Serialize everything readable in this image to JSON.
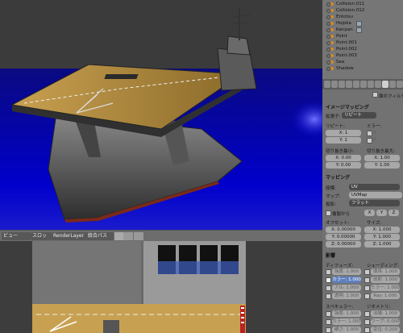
{
  "outliner": {
    "items": [
      {
        "name": "Collision.011"
      },
      {
        "name": "Collision.012"
      },
      {
        "name": "Entotsu"
      },
      {
        "name": "Hojoka"
      },
      {
        "name": "Kanpan"
      },
      {
        "name": "Point"
      },
      {
        "name": "Point.001"
      },
      {
        "name": "Point.002"
      },
      {
        "name": "Point.003"
      },
      {
        "name": "Sea"
      },
      {
        "name": "Shadow"
      }
    ]
  },
  "properties": {
    "filter_label": "面のフィルター",
    "image_mapping": {
      "title": "イメージマッピング",
      "extension_label": "拡張子:",
      "extension_value": "リピート",
      "repeat_label": "リピート:",
      "mirror_label": "ミラー:",
      "repeat_x": "X: 1",
      "repeat_y": "Y: 1",
      "mirror_x": "X",
      "mirror_y": "Y",
      "crop_min_label": "切り抜き最小:",
      "crop_max_label": "切り抜き最大:",
      "crop_min_x": "X: 0.00",
      "crop_min_y": "Y: 0.00",
      "crop_max_x": "X: 1.00",
      "crop_max_y": "Y: 1.00"
    },
    "mapping": {
      "title": "マッピング",
      "coords_label": "座標:",
      "coords_value": "UV",
      "map_label": "マップ:",
      "map_value": "UVMap",
      "projection_label": "投影:",
      "projection_value": "フラット",
      "from_dupli_label": "複製から",
      "axes": [
        "X",
        "Y",
        "Z"
      ],
      "offset_label": "オフセット:",
      "size_label": "サイズ:",
      "offset_x": "X: 0.00000",
      "offset_y": "Y: 0.00000",
      "offset_z": "Z: 0.00000",
      "size_x": "X: 1.000",
      "size_y": "Y: 1.000",
      "size_z": "Z: 1.000"
    },
    "influence": {
      "title": "影響",
      "diffuse_label": "ディフューズ:",
      "shading_label": "シェーディング:",
      "diffuse_items": [
        "強度: 1.000",
        "カラー: 1.000",
        "アル: 1.000",
        "透明: 1.000"
      ],
      "shading_items": [
        "環境: 1.000",
        "放射: 1.000",
        "ミラー: 1.000",
        "Ray: 1.000"
      ],
      "specular_label": "スペキュラー:",
      "geometry_label": "ジオメトリ:",
      "specular_items": [
        "強度: 1.000",
        "カラー: 1.000",
        "硬さ: 1.000"
      ],
      "geometry_items": [
        "法線: 1.000",
        "ワープ: 0.000",
        "変位: 0.200"
      ]
    }
  },
  "image_editor_header": {
    "view_menu": "ビュー",
    "slot_label": "スロット",
    "render_layer": "RenderLayer",
    "combined_pass": "統合パス"
  },
  "colors": {
    "sea": "#0000cc",
    "deck": "#b08a40",
    "hull": "#5a5a5a",
    "panel": "#727272",
    "outliner": "#767676"
  }
}
